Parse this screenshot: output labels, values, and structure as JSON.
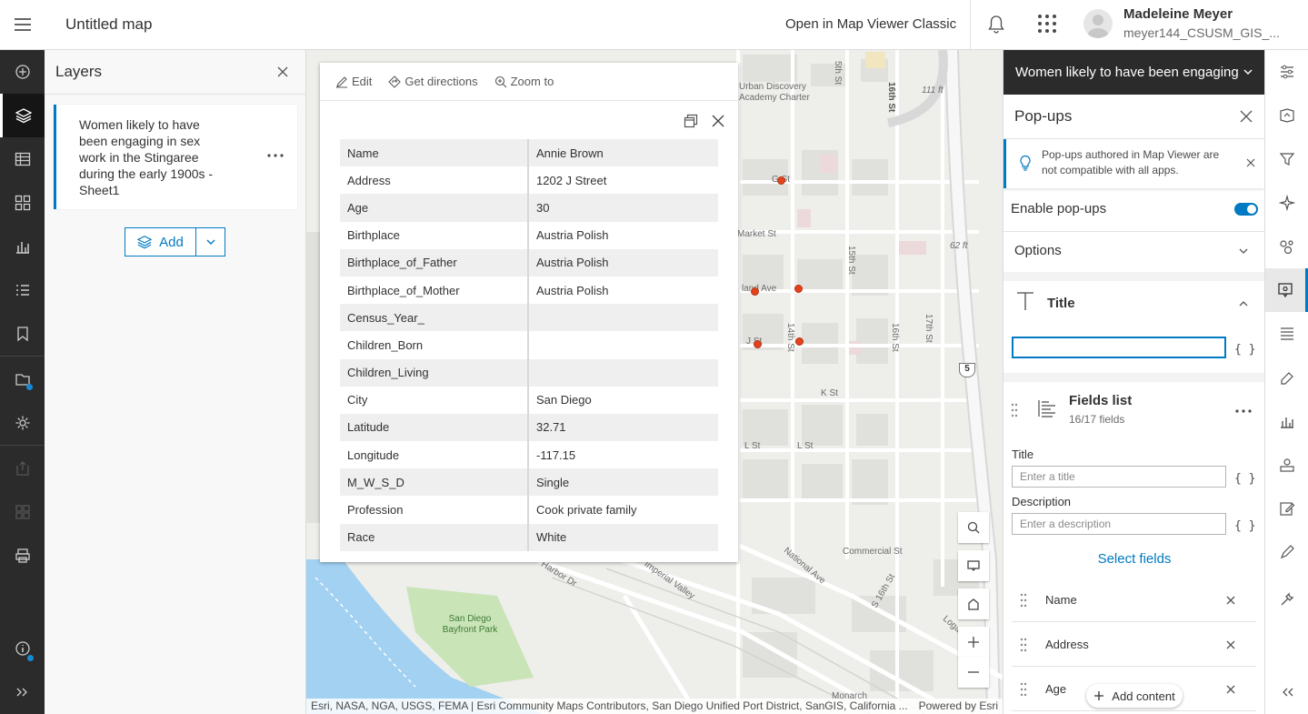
{
  "header": {
    "map_title": "Untitled map",
    "open_classic": "Open in Map Viewer Classic",
    "user_name": "Madeleine Meyer",
    "user_id": "meyer144_CSUSM_GIS_..."
  },
  "left_toolbar": {
    "items": [
      "add-icon",
      "layers-icon",
      "table-icon",
      "basemap-icon",
      "charts-icon",
      "legend-icon",
      "bookmarks-icon",
      "map-properties-icon",
      "settings-icon",
      "share-icon",
      "create-app-icon",
      "print-icon",
      "info-icon",
      "expand-icon"
    ],
    "active": "layers-icon"
  },
  "layers_panel": {
    "heading": "Layers",
    "layer_name": "Women likely to have been engaging in sex work in the Stingaree during the early 1900s - Sheet1",
    "add_label": "Add"
  },
  "popup": {
    "actions": {
      "edit": "Edit",
      "directions": "Get directions",
      "zoom": "Zoom to"
    },
    "rows": [
      {
        "field": "Name",
        "value": "Annie Brown"
      },
      {
        "field": "Address",
        "value": "1202 J Street"
      },
      {
        "field": "Age",
        "value": "30"
      },
      {
        "field": "Birthplace",
        "value": "Austria Polish"
      },
      {
        "field": "Birthplace_of_Father",
        "value": "Austria Polish"
      },
      {
        "field": "Birthplace_of_Mother",
        "value": "Austria Polish"
      },
      {
        "field": "Census_Year_",
        "value": ""
      },
      {
        "field": "Children_Born",
        "value": ""
      },
      {
        "field": "Children_Living",
        "value": ""
      },
      {
        "field": "City",
        "value": "San Diego"
      },
      {
        "field": "Latitude",
        "value": "32.71"
      },
      {
        "field": "Longitude",
        "value": "-117.15"
      },
      {
        "field": "M_W_S_D",
        "value": "Single"
      },
      {
        "field": "Profession",
        "value": "Cook private family"
      },
      {
        "field": "Race",
        "value": "White"
      }
    ]
  },
  "map": {
    "labels": {
      "school": "Urban Discovery Academy Charter",
      "elev1": "111 ft",
      "elev2": "62 ft",
      "st_5th": "5th St",
      "st_16th": "16th St",
      "st_15th": "15th St",
      "st_14th": "14th St",
      "st_17th": "17th St",
      "market": "Market St",
      "k_st": "K St",
      "l_st": "L St",
      "commercial": "Commercial St",
      "national": "National Ave",
      "harbor": "Harbor Dr",
      "imperial": "Imperial Valley",
      "park": "San Diego Bayfront Park",
      "monarch": "Monarch",
      "logan": "Logan",
      "s16th": "S 16th St",
      "i5": "5",
      "g_st": "G St",
      "j_st": "J St",
      "island": "land Ave"
    },
    "attribution": "Esri, NASA, NGA, USGS, FEMA | Esri Community Maps Contributors, San Diego Unified Port District, SanGIS, California ...",
    "powered_by": "Powered by Esri"
  },
  "right_panel": {
    "layer_selector": "Women likely to have been engaging i",
    "heading": "Pop-ups",
    "notice": "Pop-ups authored in Map Viewer are not compatible with all apps.",
    "enable_label": "Enable pop-ups",
    "enable_on": true,
    "options_label": "Options",
    "title_label": "Title",
    "braces": "{ }",
    "fields_list": {
      "title": "Fields list",
      "count": "16/17 fields"
    },
    "fl_title_label": "Title",
    "fl_title_placeholder": "Enter a title",
    "fl_desc_label": "Description",
    "fl_desc_placeholder": "Enter a description",
    "select_fields": "Select fields",
    "fields": [
      "Name",
      "Address",
      "Age"
    ],
    "add_content": "Add content"
  },
  "right_toolbar": {
    "items": [
      "properties-icon",
      "styles-icon",
      "filter-icon",
      "effects-icon",
      "clustering-icon",
      "popups-icon",
      "fields-icon",
      "labels-icon",
      "charts-icon",
      "forms-icon",
      "edit-icon",
      "sketch-icon",
      "configure-icon",
      "collapse-icon"
    ],
    "active": "popups-icon"
  },
  "colors": {
    "accent": "#007ac2",
    "toolbar_dark": "#2b2b2b",
    "poi": "#e3421e"
  }
}
